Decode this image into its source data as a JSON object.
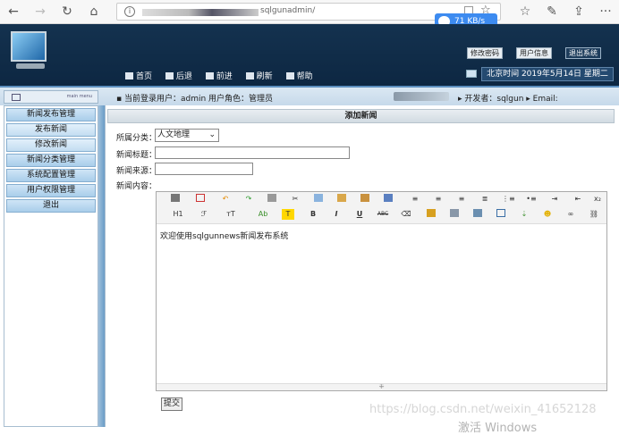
{
  "browser": {
    "url": "sqlgunadmin/",
    "speed": "71 KB/s",
    "icons": [
      "back-icon",
      "forward-icon",
      "refresh-icon",
      "home-icon",
      "reader-icon",
      "favorite-icon",
      "pen-icon",
      "share-icon",
      "more-icon"
    ]
  },
  "header": {
    "buttons": {
      "change_password": "修改密码",
      "user_info": "用户信息",
      "logout": "退出系统"
    },
    "nav": [
      "首页",
      "后退",
      "前进",
      "刷新",
      "帮助"
    ],
    "datetime": "北京时间 2019年5月14日 星期二"
  },
  "infobar": {
    "menu_title": "main menu",
    "login_text": "当前登录用户：admin 用户角色：管理员",
    "developer_text": "开发者：sqlgun",
    "email_text": "Email:"
  },
  "sidebar": {
    "items": [
      {
        "label": "新闻发布管理",
        "sub": false
      },
      {
        "label": "发布新闻",
        "sub": true
      },
      {
        "label": "修改新闻",
        "sub": true
      },
      {
        "label": "新闻分类管理",
        "sub": false
      },
      {
        "label": "系统配置管理",
        "sub": false
      },
      {
        "label": "用户权限管理",
        "sub": false
      },
      {
        "label": "退出",
        "sub": false
      }
    ]
  },
  "form": {
    "title": "添加新闻",
    "category_label": "所属分类：",
    "category_value": "人文地理",
    "title_label": "新闻标题：",
    "title_value": "",
    "source_label": "新闻来源：",
    "source_value": "",
    "content_label": "新闻内容：",
    "editor_text": "欢迎使用sqlgunnews新闻发布系统",
    "submit": "提交"
  },
  "editor_toolbar": {
    "h1": "H1",
    "font": "ℱ",
    "size": "тT",
    "color": "Ab",
    "bold": "B",
    "italic": "I",
    "underline": "U",
    "strike": "ABC"
  },
  "watermark": "https://blog.csdn.net/weixin_41652128",
  "activate": "激活 Windows"
}
